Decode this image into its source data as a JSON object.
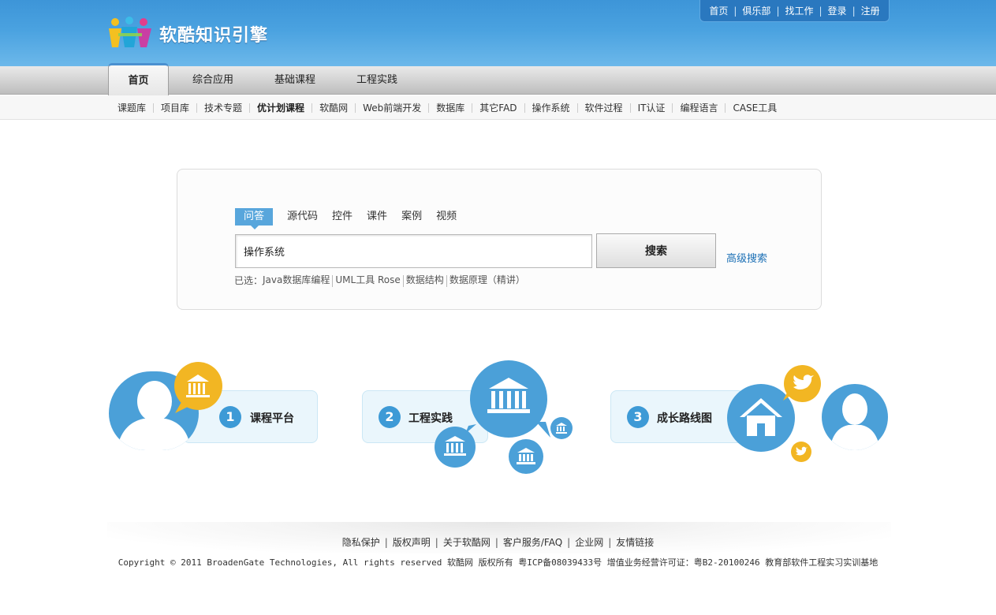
{
  "header": {
    "logo_text": "软酷知识引擎",
    "toplinks": [
      "首页",
      "俱乐部",
      "找工作",
      "登录",
      "注册"
    ]
  },
  "mainnav": {
    "tabs": [
      "首页",
      "综合应用",
      "基础课程",
      "工程实践"
    ],
    "active_index": 0
  },
  "subnav": {
    "items": [
      "课题库",
      "项目库",
      "技术专题",
      "优计划课程",
      "软酷网",
      "Web前端开发",
      "数据库",
      "其它FAD",
      "操作系统",
      "软件过程",
      "IT认证",
      "编程语言",
      "CASE工具"
    ],
    "bold_item": "优计划课程"
  },
  "search": {
    "tabs": [
      "问答",
      "源代码",
      "控件",
      "课件",
      "案例",
      "视频"
    ],
    "active_tab": "问答",
    "input_value": "操作系统",
    "button_label": "搜索",
    "advanced_label": "高级搜索",
    "selected_prefix": "已选：",
    "selected_items": [
      "Java数据库编程",
      "UML工具 Rose",
      "数据结构",
      "数据原理（精讲）"
    ]
  },
  "features": [
    {
      "num": "1",
      "label": "课程平台"
    },
    {
      "num": "2",
      "label": "工程实践"
    },
    {
      "num": "3",
      "label": "成长路线图"
    }
  ],
  "footer": {
    "links": [
      "隐私保护",
      "版权声明",
      "关于软酷网",
      "客户服务/FAQ",
      "企业网",
      "友情链接"
    ],
    "copyright": "Copyright © 2011 BroadenGate Technologies, All rights reserved 软酷网 版权所有 粤ICP备08039433号 增值业务经营许可证：粤B2-20100246 教育部软件工程实习实训基地"
  },
  "colors": {
    "header_blue": "#4aa2e0",
    "accent_blue": "#4ba0d8",
    "accent_yellow": "#f2b623",
    "link_blue": "#1b6fb5"
  }
}
